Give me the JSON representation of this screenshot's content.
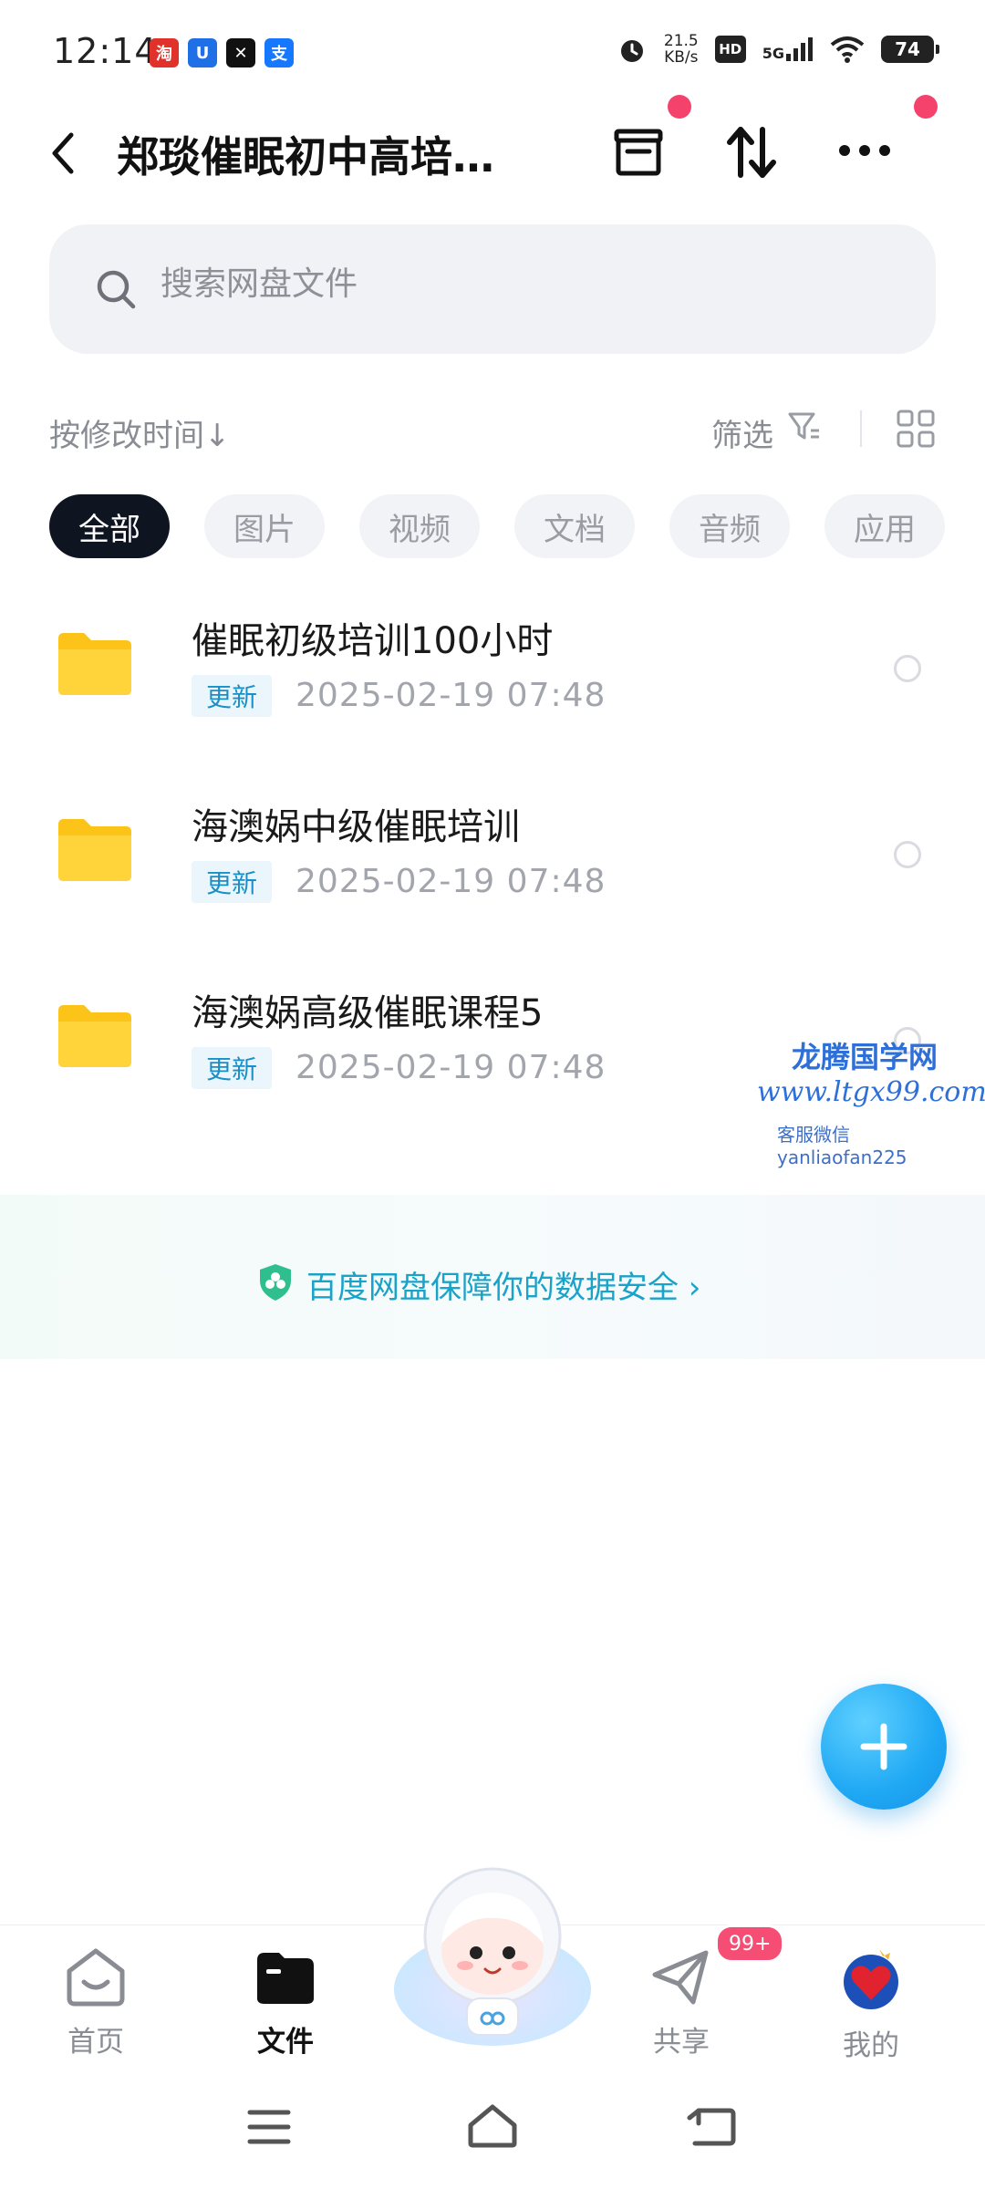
{
  "status_bar": {
    "time": "12:14",
    "net_speed_value": "21.5",
    "net_speed_unit": "KB/s",
    "hd": "HD",
    "network": "5G",
    "battery": "74"
  },
  "header": {
    "title": "郑琰催眠初中高培…"
  },
  "search": {
    "placeholder": "搜索网盘文件"
  },
  "sort": {
    "label": "按修改时间↓",
    "filter_label": "筛选"
  },
  "chips": [
    "全部",
    "图片",
    "视频",
    "文档",
    "音频",
    "应用"
  ],
  "files": [
    {
      "name": "催眠初级培训100小时",
      "badge": "更新",
      "date": "2025-02-19  07:48"
    },
    {
      "name": "海澳娲中级催眠培训",
      "badge": "更新",
      "date": "2025-02-19  07:48"
    },
    {
      "name": "海澳娲高级催眠课程5",
      "badge": "更新",
      "date": "2025-02-19  07:48"
    }
  ],
  "watermark": {
    "line1": "龙腾国学网",
    "line2": "www.ltgx99.com",
    "line3": "客服微信 yanliaofan225"
  },
  "safety": {
    "text": "百度网盘保障你的数据安全 ›"
  },
  "bottom_nav": {
    "home": "首页",
    "files": "文件",
    "share": "共享",
    "share_badge": "99+",
    "mine": "我的"
  },
  "colors": {
    "accent": "#1aa3c9",
    "active_chip": "#0e1420",
    "red_dot": "#f5426c",
    "folder": "#fcc419",
    "fab": "#1fa8f4"
  }
}
